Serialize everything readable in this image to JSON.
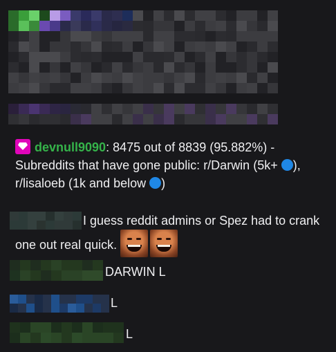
{
  "messages": [
    {
      "username": "devnull9090",
      "separator": ": ",
      "text_part1": "8475 out of 8839 (95.882%) - Subreddits that have gone public: r/Darwin (5k+ ",
      "text_part2": "), r/lisaloeb (1k and below ",
      "text_part3": ")",
      "user_color": "#35b34a",
      "badge_color": "#e005b9",
      "icons": [
        "gem-badge-icon",
        "blue-circle-emoji-icon"
      ]
    },
    {
      "text": "I guess reddit admins or Spez had to crank one out real quick.",
      "emote": "laughing-man-emote-icon"
    },
    {
      "text": "DARWIN L"
    },
    {
      "text": "L"
    },
    {
      "text": "L"
    }
  ],
  "colors": {
    "background": "#18181b",
    "text": "#efeff1",
    "blue_dot": "#1f87e5"
  }
}
